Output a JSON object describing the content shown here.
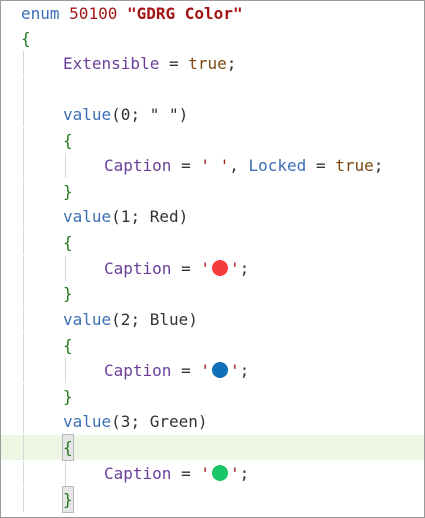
{
  "enum_line": {
    "keyword": "enum",
    "id": "50100",
    "name": "\"GDRG Color\""
  },
  "open_brace": "{",
  "close_brace": "}",
  "extensible": {
    "prop": "Extensible",
    "eq": " = ",
    "value": "true",
    "semi": ";"
  },
  "values": [
    {
      "keyword": "value",
      "args": "(0; \" \")",
      "caption_prop": "Caption",
      "eq": " = ",
      "caption_text": "' '",
      "sep": ", ",
      "locked_prop": "Locked",
      "locked_value": "true",
      "semi": ";"
    },
    {
      "keyword": "value",
      "args": "(1; Red)",
      "caption_prop": "Caption",
      "eq": " = ",
      "quote": "'",
      "semi": ";",
      "icon": "red-circle-emoji",
      "color": "#f23b3b"
    },
    {
      "keyword": "value",
      "args": "(2; Blue)",
      "caption_prop": "Caption",
      "eq": " = ",
      "quote": "'",
      "semi": ";",
      "icon": "blue-circle-emoji",
      "color": "#0f6fb8"
    },
    {
      "keyword": "value",
      "args": "(3; Green)",
      "caption_prop": "Caption",
      "eq": " = ",
      "quote": "'",
      "semi": ";",
      "icon": "green-circle-emoji",
      "color": "#19c667"
    }
  ],
  "colors": {
    "current_line": "#edf7e4",
    "keyword": "#3b6fb5",
    "string": "#a31515",
    "property": "#6b3f99",
    "brace": "#1f7a1f"
  }
}
